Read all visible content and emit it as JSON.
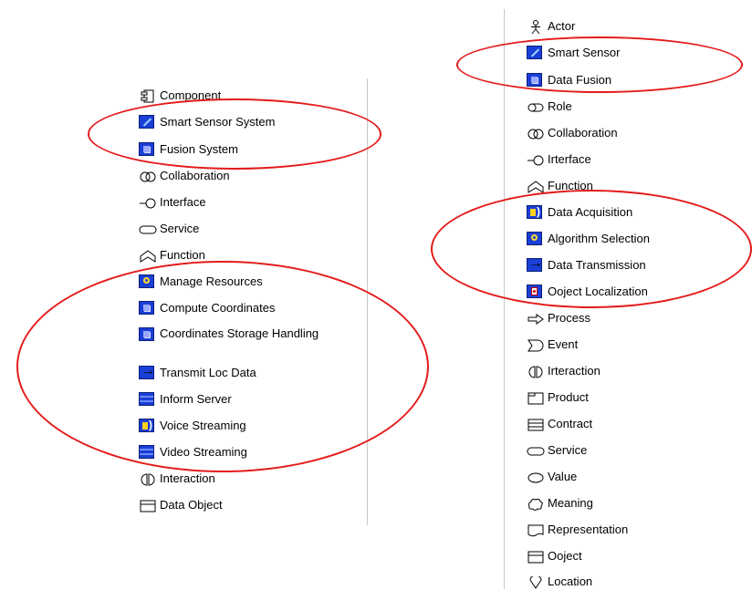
{
  "left_palette": {
    "items": [
      {
        "label": "Component",
        "icon": "component-icon"
      },
      {
        "label": "Smart Sensor System",
        "icon": "smart-sensor-icon"
      },
      {
        "label": "Fusion System",
        "icon": "fusion-icon"
      },
      {
        "label": "Collaboration",
        "icon": "collaboration-icon"
      },
      {
        "label": "Interface",
        "icon": "interface-icon"
      },
      {
        "label": "Service",
        "icon": "service-icon"
      },
      {
        "label": "Function",
        "icon": "function-icon"
      },
      {
        "label": "Manage Resources",
        "icon": "gear-icon"
      },
      {
        "label": "Compute Coordinates",
        "icon": "fusion-icon"
      },
      {
        "label": " Coordinates Storage Handling",
        "icon": "fusion-icon"
      },
      {
        "label": "Transmit Loc Data",
        "icon": "arrow-icon"
      },
      {
        "label": "Inform Server",
        "icon": "server-icon"
      },
      {
        "label": "Voice Streaming",
        "icon": "speaker-icon"
      },
      {
        "label": "Video Streaming",
        "icon": "server-icon"
      },
      {
        "label": "Interaction",
        "icon": "interaction-icon"
      },
      {
        "label": "Data Object",
        "icon": "data-object-icon"
      }
    ]
  },
  "right_palette": {
    "items": [
      {
        "label": "Actor",
        "icon": "actor-icon"
      },
      {
        "label": "Smart Sensor",
        "icon": "smart-sensor-icon"
      },
      {
        "label": "Data Fusion",
        "icon": "fusion-icon"
      },
      {
        "label": "Role",
        "icon": "role-icon"
      },
      {
        "label": "Collaboration",
        "icon": "collaboration-icon"
      },
      {
        "label": "Irterface",
        "icon": "interface-icon"
      },
      {
        "label": "Function",
        "icon": "function-icon"
      },
      {
        "label": "Data Acquisition",
        "icon": "speaker-icon"
      },
      {
        "label": "Algorithm Selection",
        "icon": "gear-icon"
      },
      {
        "label": "Data Transmission",
        "icon": "arrow-icon"
      },
      {
        "label": "Ooject Localization",
        "icon": "locate-icon"
      },
      {
        "label": "Process",
        "icon": "process-icon"
      },
      {
        "label": "Event",
        "icon": "event-icon"
      },
      {
        "label": "Irteraction",
        "icon": "interaction-icon"
      },
      {
        "label": "Product",
        "icon": "product-icon"
      },
      {
        "label": "Contract",
        "icon": "contract-icon"
      },
      {
        "label": "Service",
        "icon": "service-icon"
      },
      {
        "label": "Value",
        "icon": "value-icon"
      },
      {
        "label": "Meaning",
        "icon": "meaning-icon"
      },
      {
        "label": "Representation",
        "icon": "representation-icon"
      },
      {
        "label": "Ooject",
        "icon": "data-object-icon"
      },
      {
        "label": "Location",
        "icon": "location-icon"
      }
    ]
  },
  "colors": {
    "highlight_ellipse": "#e41b1b",
    "icon_blue": "#1a3fd6"
  }
}
